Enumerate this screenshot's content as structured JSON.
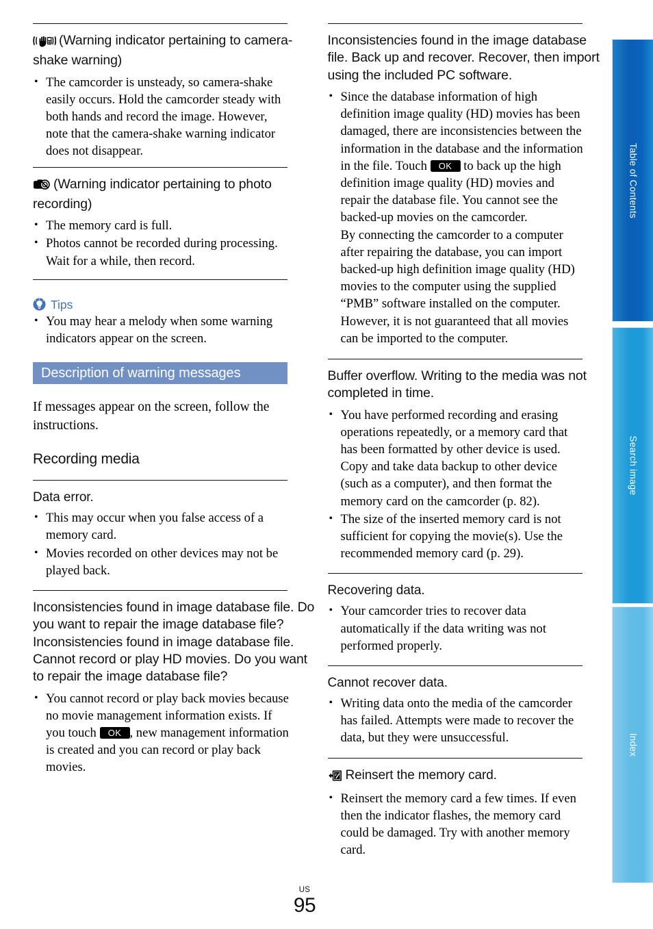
{
  "page": {
    "locale_label": "US",
    "number": "95"
  },
  "side_tabs": [
    {
      "label": "Table of Contents",
      "name": "table-of-contents",
      "color": "#0b5fb4"
    },
    {
      "label": "Search image",
      "name": "search-image",
      "color": "#1e9ad8"
    },
    {
      "label": "Index",
      "name": "index",
      "color": "#62bde6"
    }
  ],
  "left_column": {
    "camera_shake": {
      "icon": "camera-shake-warning-icon",
      "heading": "(Warning indicator pertaining to camera-shake warning)",
      "bullets": [
        "The camcorder is unsteady, so camera-shake easily occurs. Hold the camcorder steady with both hands and record the image. However, note that the camera-shake warning indicator does not disappear."
      ]
    },
    "photo_recording": {
      "icon": "photo-recording-warning-icon",
      "heading": "(Warning indicator pertaining to photo recording)",
      "bullets": [
        "The memory card is full.",
        "Photos cannot be recorded during processing. Wait for a while, then record."
      ]
    },
    "tips": {
      "icon": "lightbulb-tips-icon",
      "label": "Tips",
      "color": "#4472b8",
      "bullets": [
        "You may hear a melody when some warning indicators appear on the screen."
      ]
    },
    "section_banner": {
      "title": "Description of warning messages",
      "background": "#7190c4",
      "text_color": "#ffffff"
    },
    "intro": "If messages appear on the screen, follow the instructions.",
    "group_heading": "Recording media",
    "messages": [
      {
        "heading": "Data error.",
        "bullets": [
          "This may occur when you false access of a memory card.",
          "Movies recorded on other devices may not be played back."
        ]
      },
      {
        "heading_line_1": "Inconsistencies found in image database file. Do you want to repair the image database file?",
        "heading_line_2": "Inconsistencies found in image database file. Cannot record or play HD movies. Do you want to repair the image database file?",
        "bullet_part_1": "You cannot record or play back movies because no movie management information exists. If you touch ",
        "ok_key": "OK",
        "bullet_part_2": ", new management information is created and you can record or play back movies."
      }
    ]
  },
  "right_column": {
    "messages": [
      {
        "heading": "Inconsistencies found in the image database file. Back up and recover. Recover, then import using the included PC software.",
        "bullet_part_1": "Since the database information of high definition image quality (HD) movies has been damaged, there are inconsistencies between the information in the database and the information in the file. Touch ",
        "ok_key": "OK",
        "bullet_part_2": " to back up the high definition image quality (HD) movies and repair the database file. You cannot see the backed-up movies on the camcorder.",
        "bullet_part_3": "By connecting the camcorder to a computer after repairing the database, you can import backed-up high definition image quality (HD) movies to the computer using the supplied “PMB” software installed on the computer. However, it is not guaranteed that all movies can be imported to the computer."
      },
      {
        "heading": "Buffer overflow. Writing to the media was not completed in time.",
        "bullets": [
          "You have performed recording and erasing operations repeatedly, or a memory card that has been formatted by other device is used. Copy and take data backup to other device (such as a computer), and then format the memory card on the camcorder (p. 82).",
          "The size of the inserted memory card is not sufficient for copying the movie(s). Use the recommended memory card (p. 29)."
        ]
      },
      {
        "heading": "Recovering data.",
        "bullets": [
          "Your camcorder tries to recover data automatically if the data writing was not performed properly."
        ]
      },
      {
        "heading": "Cannot recover data.",
        "bullets": [
          "Writing data onto the media of the camcorder has failed. Attempts were made to recover the data, but they were unsuccessful."
        ]
      },
      {
        "icon": "reinsert-memory-card-icon",
        "heading": "Reinsert the memory card.",
        "bullets": [
          "Reinsert the memory card a few times. If even then the indicator flashes, the memory card could be damaged. Try with another memory card."
        ]
      }
    ]
  }
}
